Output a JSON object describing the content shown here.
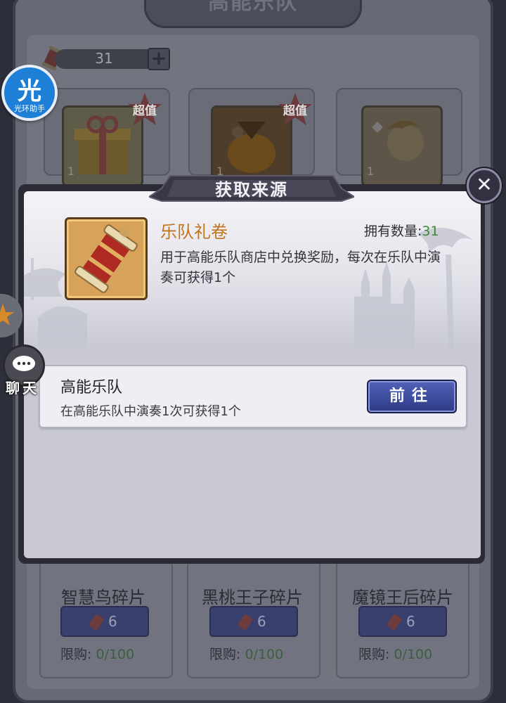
{
  "background_shop": {
    "title": "高能乐队",
    "currency_value": "31",
    "items": [
      {
        "qty": "1",
        "badge": "超值"
      },
      {
        "qty": "1",
        "badge": "超值"
      },
      {
        "qty": "1"
      }
    ],
    "bottom_items": [
      {
        "name": "智慧鸟碎片",
        "price": "6",
        "limit_label": "限购:",
        "limit_value": "0/100"
      },
      {
        "name": "黑桃王子碎片",
        "price": "6",
        "limit_label": "限购:",
        "limit_value": "0/100"
      },
      {
        "name": "魔镜王后碎片",
        "price": "6",
        "limit_label": "限购:",
        "limit_value": "0/100"
      }
    ]
  },
  "overlay": {
    "helper_char": "光",
    "helper_label": "光环助手",
    "chat_label": "聊天"
  },
  "dialog": {
    "title": "获取来源",
    "close_symbol": "✕",
    "item": {
      "name": "乐队礼卷",
      "owned_label": "拥有数量:",
      "owned_value": "31",
      "description": "用于高能乐队商店中兑换奖励，每次在乐队中演奏可获得1个"
    },
    "sources": [
      {
        "name": "高能乐队",
        "description": "在高能乐队中演奏1次可获得1个",
        "button": "前往"
      }
    ]
  },
  "colors": {
    "item_name": "#c0751c",
    "owned_value": "#3a8a3a",
    "goto_button": "#3a46a0"
  }
}
